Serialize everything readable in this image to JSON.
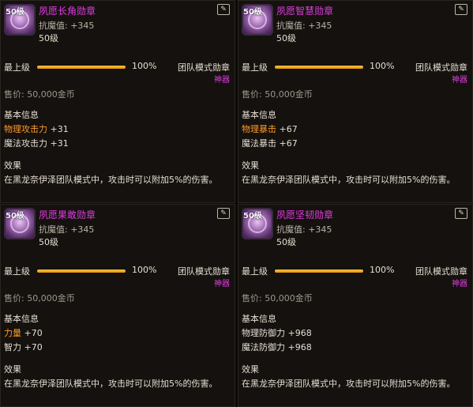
{
  "cards": [
    {
      "name": "夙愿长角勋章",
      "level_badge": "50级",
      "resist_label": "抗魔值: ",
      "resist_value": "+345",
      "level": "50级",
      "upgrade_label": "最上级",
      "upgrade_percent": "100%",
      "upgrade_fill": 1.0,
      "mode": "团队模式勋章",
      "rarity": "神器",
      "price": "售价: 50,000金币",
      "basic_info": "基本信息",
      "stats": [
        {
          "key": "物理攻击力",
          "value": " +31",
          "highlight": true
        },
        {
          "key": "魔法攻击力",
          "value": " +31",
          "highlight": false
        }
      ],
      "effect_title": "效果",
      "effect_text": "在黑龙奈伊泽团队模式中，攻击时可以附加5%的伤害。"
    },
    {
      "name": "夙愿智慧勋章",
      "level_badge": "50级",
      "resist_label": "抗魔值: ",
      "resist_value": "+345",
      "level": "50级",
      "upgrade_label": "最上级",
      "upgrade_percent": "100%",
      "upgrade_fill": 1.0,
      "mode": "团队模式勋章",
      "rarity": "神器",
      "price": "售价: 50,000金币",
      "basic_info": "基本信息",
      "stats": [
        {
          "key": "物理暴击",
          "value": " +67",
          "highlight": true
        },
        {
          "key": "魔法暴击",
          "value": " +67",
          "highlight": false
        }
      ],
      "effect_title": "效果",
      "effect_text": "在黑龙奈伊泽团队模式中，攻击时可以附加5%的伤害。"
    },
    {
      "name": "夙愿果敢勋章",
      "level_badge": "50级",
      "resist_label": "抗魔值: ",
      "resist_value": "+345",
      "level": "50级",
      "upgrade_label": "最上级",
      "upgrade_percent": "100%",
      "upgrade_fill": 1.0,
      "mode": "团队模式勋章",
      "rarity": "神器",
      "price": "售价: 50,000金币",
      "basic_info": "基本信息",
      "stats": [
        {
          "key": "力量",
          "value": " +70",
          "highlight": true
        },
        {
          "key": "智力",
          "value": " +70",
          "highlight": false
        }
      ],
      "effect_title": "效果",
      "effect_text": "在黑龙奈伊泽团队模式中，攻击时可以附加5%的伤害。"
    },
    {
      "name": "夙愿坚韧勋章",
      "level_badge": "50级",
      "resist_label": "抗魔值: ",
      "resist_value": "+345",
      "level": "50级",
      "upgrade_label": "最上级",
      "upgrade_percent": "100%",
      "upgrade_fill": 1.0,
      "mode": "团队模式勋章",
      "rarity": "神器",
      "price": "售价: 50,000金币",
      "basic_info": "基本信息",
      "stats": [
        {
          "key": "物理防御力",
          "value": " +968",
          "highlight": false
        },
        {
          "key": "魔法防御力",
          "value": " +968",
          "highlight": false
        }
      ],
      "effect_title": "效果",
      "effect_text": "在黑龙奈伊泽团队模式中，攻击时可以附加5%的伤害。"
    }
  ],
  "colors": {
    "name": "#e03ce0",
    "rarity": "#e03ce0",
    "stat_highlight": "#ff9a2b",
    "bar_fill": "#ffb12a"
  },
  "icons": {
    "corner": "share-edit-icon",
    "medal": "medal-icon"
  }
}
